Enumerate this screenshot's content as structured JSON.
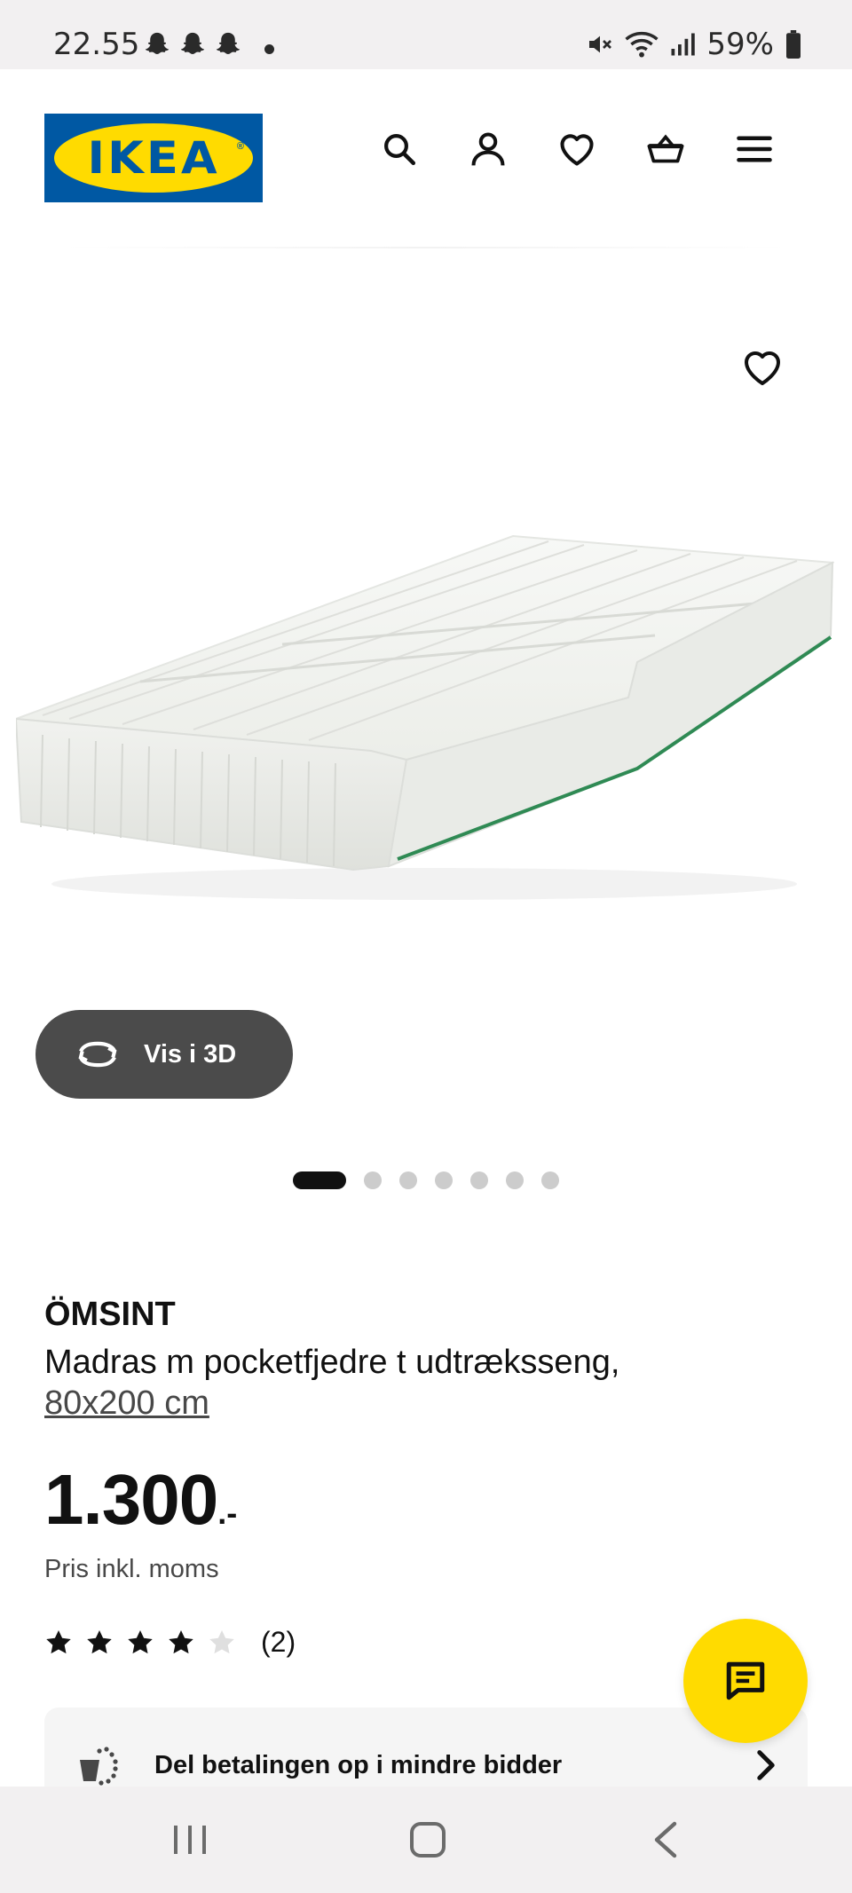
{
  "status_bar": {
    "time": "22.55",
    "battery": "59%"
  },
  "header": {
    "logo_text": "IKEA",
    "logo_mark": "®",
    "icons": [
      "search-icon",
      "account-icon",
      "heart-icon",
      "basket-icon",
      "menu-icon"
    ]
  },
  "product_images": {
    "view_3d_label": "Vis i 3D",
    "carousel_count": 7,
    "active_index": 0
  },
  "product": {
    "name": "ÖMSINT",
    "description": "Madras m pocketfjedre t udtræksseng,",
    "size": "80x200 cm",
    "price": "1.300",
    "price_suffix": ".-",
    "price_note": "Pris inkl. moms",
    "rating_stars": 4,
    "rating_max": 5,
    "rating_count": "(2)"
  },
  "payment_banner": {
    "label": "Del betalingen op i mindre bidder"
  },
  "colors": {
    "ikea_blue": "#0058a3",
    "ikea_yellow": "#ffdb00",
    "button_dark": "#4b4b4b",
    "text_primary": "#111111"
  }
}
